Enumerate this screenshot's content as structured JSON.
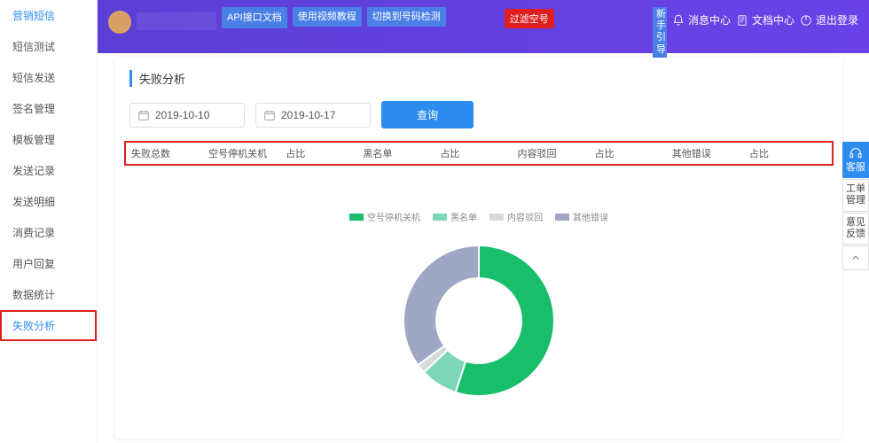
{
  "sidebar": {
    "items": [
      {
        "label": "营销短信",
        "active": true
      },
      {
        "label": "短信测试"
      },
      {
        "label": "短信发送"
      },
      {
        "label": "签名管理"
      },
      {
        "label": "模板管理"
      },
      {
        "label": "发送记录"
      },
      {
        "label": "发送明细"
      },
      {
        "label": "消费记录"
      },
      {
        "label": "用户回复"
      },
      {
        "label": "数据统计"
      },
      {
        "label": "失败分析",
        "highlighted": true
      }
    ]
  },
  "header": {
    "api_doc": "API接口文档",
    "video_tutorial": "使用视频教程",
    "switch_check": "切换到号码检测",
    "filter_empty": "过滤空号",
    "beginner_guide": "新手引导",
    "msg_center": "消息中心",
    "doc_center": "文档中心",
    "logout": "退出登录"
  },
  "card": {
    "title": "失败分析",
    "date_from": "2019-10-10",
    "date_to": "2019-10-17",
    "query": "查询"
  },
  "table": {
    "headers": [
      "失败总数",
      "空号停机关机",
      "占比",
      "黑名单",
      "占比",
      "内容驳回",
      "占比",
      "其他错误",
      "占比"
    ]
  },
  "chart_data": {
    "type": "pie",
    "title": "",
    "series": [
      {
        "name": "空号停机关机",
        "value": 55,
        "color": "#19be6b"
      },
      {
        "name": "黑名单",
        "value": 8,
        "color": "#7ed6b8"
      },
      {
        "name": "内容驳回",
        "value": 2,
        "color": "#d9d9d9"
      },
      {
        "name": "其他错误",
        "value": 35,
        "color": "#9ea7c4"
      }
    ]
  },
  "right_rail": {
    "service": "客服",
    "ticket": "工单管理",
    "feedback": "意见反馈"
  }
}
